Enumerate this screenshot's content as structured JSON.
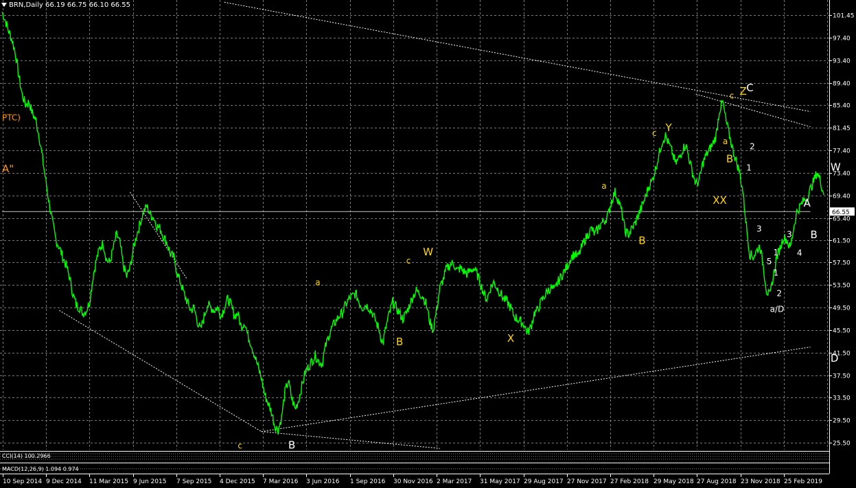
{
  "window": {
    "title": "BRN,Daily",
    "ohlc": "66.19 66.75 66.10 66.55"
  },
  "price_tag": "66.55",
  "colors": {
    "background": "#000000",
    "grid": "#7a7a7a",
    "price_line": "#00ff00",
    "yellow_label": "#ffd700",
    "orange_label": "#ff9900",
    "white_label": "#ffffff",
    "trend_line": "#ffffff"
  },
  "indicators": {
    "cci": "CCI(14) 100.2966",
    "macd": "MACD(12,26,9) 1.094 0.974"
  },
  "chart_data": {
    "type": "line",
    "symbol": "BRN",
    "timeframe": "Daily",
    "ylim": [
      24.3,
      104.1
    ],
    "y_ticks": [
      "101.45",
      "97.40",
      "93.40",
      "89.40",
      "85.40",
      "81.45",
      "77.40",
      "73.40",
      "69.40",
      "65.40",
      "61.50",
      "57.50",
      "53.50",
      "49.50",
      "45.50",
      "41.50",
      "37.50",
      "33.50",
      "29.50",
      "25.50"
    ],
    "x_ticks": [
      "10 Sep 2014",
      "9 Dec 2014",
      "11 Mar 2015",
      "9 Jun 2015",
      "7 Sep 2015",
      "4 Dec 2015",
      "7 Mar 2016",
      "3 Jun 2016",
      "1 Sep 2016",
      "30 Nov 2016",
      "2 Mar 2017",
      "31 May 2017",
      "29 Aug 2017",
      "27 Nov 2017",
      "27 Feb 2018",
      "29 May 2018",
      "27 Aug 2018",
      "23 Nov 2018",
      "25 Feb 2019"
    ],
    "x_index": [
      0,
      1,
      2,
      3,
      4,
      5,
      6,
      7,
      8,
      9,
      10,
      11,
      12,
      13,
      14,
      15,
      16,
      17,
      18,
      19,
      20,
      21,
      22,
      23,
      24,
      25,
      26,
      27,
      28,
      29,
      30,
      31,
      32,
      33,
      34,
      35,
      36,
      37,
      38,
      39,
      40,
      41,
      42,
      43,
      44,
      45,
      46,
      47,
      48,
      49,
      50,
      51,
      52,
      53,
      54,
      55,
      56,
      57,
      58,
      59,
      60,
      61,
      62,
      63,
      64,
      65,
      66,
      67,
      68,
      69,
      70,
      71,
      72,
      73,
      74,
      75,
      76,
      77,
      78,
      79,
      80,
      81,
      82,
      83,
      84,
      85,
      86,
      87,
      88,
      89,
      90,
      91,
      92,
      93,
      94,
      95,
      96,
      97,
      98,
      99,
      100,
      101,
      102,
      103,
      104,
      105,
      106,
      107,
      108,
      109,
      110,
      111,
      112,
      113,
      114,
      115,
      116,
      117,
      118,
      119,
      120,
      121,
      122,
      123,
      124,
      125,
      126,
      127,
      128,
      129,
      130,
      131,
      132,
      133,
      134,
      135,
      136,
      137,
      138,
      139,
      140,
      141,
      142,
      143,
      144,
      145,
      146,
      147,
      148,
      149,
      150,
      151,
      152,
      153,
      154,
      155,
      156,
      157,
      158,
      159,
      160,
      161,
      162,
      163,
      164,
      165,
      166,
      167,
      168,
      169,
      170,
      171,
      172,
      173,
      174,
      175,
      176,
      177,
      178,
      179,
      180,
      181,
      182,
      183,
      184,
      185,
      186,
      187,
      188,
      189,
      190,
      191,
      192,
      193,
      194,
      195,
      196,
      197,
      198,
      199,
      200,
      201,
      202,
      203,
      204,
      205,
      206,
      207,
      208,
      209,
      210,
      211,
      212,
      213,
      214,
      215,
      216,
      217,
      218,
      219,
      220,
      221,
      222,
      223,
      224,
      225,
      226,
      227,
      228,
      229,
      230,
      231,
      232,
      233,
      234,
      235,
      236,
      237,
      238,
      239,
      240
    ],
    "close": [
      102.0,
      100.4,
      98.5,
      97.0,
      94.5,
      90.5,
      87.2,
      85.5,
      86.0,
      84.0,
      82.8,
      80.0,
      76.0,
      72.0,
      68.0,
      64.5,
      61.5,
      60.2,
      58.5,
      57.0,
      55.0,
      52.0,
      50.0,
      49.5,
      48.5,
      49.0,
      50.5,
      55.0,
      58.0,
      60.0,
      61.0,
      58.0,
      57.5,
      60.0,
      62.5,
      61.0,
      57.0,
      55.0,
      56.5,
      60.0,
      62.5,
      64.5,
      66.5,
      67.5,
      66.0,
      65.5,
      64.0,
      63.5,
      62.0,
      61.0,
      59.0,
      58.5,
      55.5,
      54.0,
      52.0,
      50.5,
      49.0,
      49.5,
      47.0,
      45.5,
      48.0,
      50.0,
      49.5,
      49.0,
      49.5,
      48.0,
      49.5,
      51.0,
      50.0,
      48.0,
      48.5,
      46.0,
      47.0,
      44.5,
      43.0,
      41.0,
      39.0,
      37.0,
      34.0,
      32.5,
      31.0,
      28.5,
      27.8,
      30.0,
      34.5,
      36.5,
      33.5,
      31.5,
      33.0,
      35.5,
      38.0,
      39.0,
      40.0,
      41.0,
      40.0,
      39.5,
      42.5,
      44.5,
      46.0,
      47.0,
      48.0,
      48.5,
      50.0,
      51.0,
      51.5,
      52.0,
      50.5,
      49.5,
      50.0,
      49.5,
      48.5,
      47.0,
      45.5,
      43.0,
      46.0,
      48.5,
      50.5,
      49.5,
      48.5,
      47.5,
      48.5,
      50.0,
      51.5,
      52.5,
      52.0,
      51.5,
      50.0,
      47.0,
      45.5,
      49.0,
      53.0,
      54.5,
      56.5,
      57.0,
      57.5,
      56.0,
      56.5,
      56.0,
      55.5,
      56.0,
      56.5,
      55.5,
      54.0,
      52.0,
      51.0,
      53.0,
      54.0,
      53.0,
      52.0,
      51.0,
      50.5,
      49.5,
      48.0,
      47.5,
      47.0,
      46.5,
      45.0,
      46.0,
      48.5,
      49.0,
      50.5,
      51.5,
      52.5,
      53.0,
      52.5,
      54.0,
      55.0,
      56.0,
      57.0,
      58.5,
      59.0,
      58.5,
      60.0,
      61.5,
      62.5,
      63.5,
      62.5,
      63.5,
      64.5,
      65.0,
      66.0,
      68.5,
      70.0,
      68.5,
      66.5,
      63.0,
      62.5,
      63.5,
      64.5,
      66.0,
      67.5,
      69.0,
      71.0,
      72.0,
      74.0,
      76.5,
      79.0,
      80.0,
      78.5,
      77.0,
      75.0,
      76.0,
      77.5,
      78.5,
      76.0,
      73.5,
      71.5,
      72.0,
      75.0,
      76.5,
      77.5,
      78.5,
      80.0,
      84.5,
      86.0,
      82.5,
      80.0,
      77.5,
      75.5,
      73.5,
      70.0,
      64.0,
      59.0,
      58.5,
      59.5,
      60.5,
      57.0,
      52.5,
      51.5,
      55.0,
      58.5,
      60.0,
      62.0,
      61.5,
      60.0,
      63.5,
      66.5,
      67.5,
      68.5,
      69.0,
      70.5,
      72.0,
      73.5,
      72.0,
      69.5
    ],
    "trend_lines": [
      {
        "from": [
          66,
          103.7
        ],
        "to": [
          240,
          84.3
        ]
      },
      {
        "from": [
          206,
          87.4
        ],
        "to": [
          240,
          81.6
        ]
      },
      {
        "from": [
          17,
          49.0
        ],
        "to": [
          77,
          27.5
        ]
      },
      {
        "from": [
          77,
          27.5
        ],
        "to": [
          240,
          42.5
        ]
      },
      {
        "from": [
          77,
          27.5
        ],
        "to": [
          130,
          24.5
        ]
      },
      {
        "from": [
          38,
          70.0
        ],
        "to": [
          55,
          54.5
        ]
      },
      {
        "from": [
          0,
          66.55
        ],
        "to": [
          240,
          66.55
        ]
      }
    ],
    "wave_labels": [
      {
        "text": "PTC)",
        "x": 0,
        "y": 82.7,
        "color": "orange"
      },
      {
        "text": "A\"",
        "x": 0,
        "y": 73.5,
        "color": "orange"
      },
      {
        "text": "a",
        "x": 93,
        "y": 53.5,
        "color": "yellow"
      },
      {
        "text": "B",
        "x": 117,
        "y": 42.8,
        "color": "yellow"
      },
      {
        "text": "c",
        "x": 120,
        "y": 57.3,
        "color": "yellow"
      },
      {
        "text": "W",
        "x": 125,
        "y": 58.8,
        "color": "yellow"
      },
      {
        "text": "X",
        "x": 150,
        "y": 43.4,
        "color": "yellow"
      },
      {
        "text": "a",
        "x": 178,
        "y": 70.6,
        "color": "yellow"
      },
      {
        "text": "B",
        "x": 189,
        "y": 60.8,
        "color": "yellow"
      },
      {
        "text": "c",
        "x": 193,
        "y": 80.0,
        "color": "yellow"
      },
      {
        "text": "Y",
        "x": 197,
        "y": 80.8,
        "color": "yellow"
      },
      {
        "text": "XX",
        "x": 211,
        "y": 67.9,
        "color": "yellow"
      },
      {
        "text": "a",
        "x": 214,
        "y": 78.5,
        "color": "yellow"
      },
      {
        "text": "B",
        "x": 215,
        "y": 75.3,
        "color": "yellow"
      },
      {
        "text": "c",
        "x": 216,
        "y": 86.6,
        "color": "yellow"
      },
      {
        "text": "Z",
        "x": 219,
        "y": 87.3,
        "color": "yellow"
      },
      {
        "text": "C",
        "x": 221,
        "y": 87.9,
        "color": "white"
      },
      {
        "text": "2",
        "x": 222,
        "y": 77.6,
        "color": "white"
      },
      {
        "text": "1",
        "x": 221,
        "y": 73.8,
        "color": "white"
      },
      {
        "text": "3",
        "x": 224,
        "y": 63.0,
        "color": "white"
      },
      {
        "text": "5",
        "x": 227,
        "y": 57.2,
        "color": "white"
      },
      {
        "text": "1",
        "x": 229,
        "y": 58.8,
        "color": "white"
      },
      {
        "text": "1",
        "x": 229,
        "y": 55.2,
        "color": "white"
      },
      {
        "text": "2",
        "x": 230,
        "y": 51.5,
        "color": "white"
      },
      {
        "text": "a/D",
        "x": 228,
        "y": 48.7,
        "color": "white"
      },
      {
        "text": "3",
        "x": 233,
        "y": 62.0,
        "color": "white"
      },
      {
        "text": "4",
        "x": 236,
        "y": 58.7,
        "color": "white"
      },
      {
        "text": "A",
        "x": 238,
        "y": 67.4,
        "color": "white"
      },
      {
        "text": "B",
        "x": 240,
        "y": 61.8,
        "color": "white"
      },
      {
        "text": "W",
        "x": 246,
        "y": 73.8,
        "color": "white"
      },
      {
        "text": "D",
        "x": 246,
        "y": 39.9,
        "color": "white"
      },
      {
        "text": "c",
        "x": 70,
        "y": 24.5,
        "color": "yellow"
      },
      {
        "text": "B",
        "x": 85,
        "y": 24.5,
        "color": "white"
      }
    ]
  }
}
